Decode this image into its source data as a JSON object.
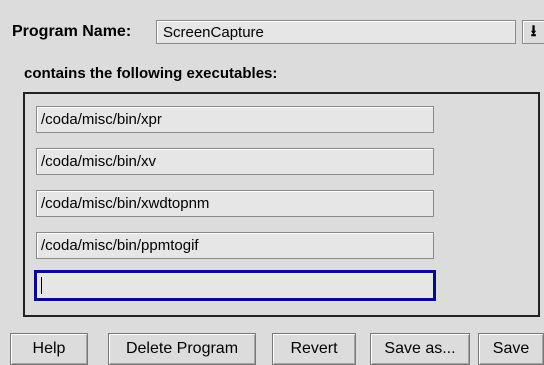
{
  "program": {
    "label": "Program Name:",
    "value": "ScreenCapture",
    "dropdown_icon": "download-arrow-icon"
  },
  "executables": {
    "heading": "contains the following executables:",
    "items": [
      "/coda/misc/bin/xpr",
      "/coda/misc/bin/xv",
      "/coda/misc/bin/xwdtopnm",
      "/coda/misc/bin/ppmtogif"
    ],
    "new_entry_value": ""
  },
  "buttons": {
    "help": "Help",
    "delete_program": "Delete Program",
    "revert": "Revert",
    "save_as": "Save as...",
    "save": "Save"
  },
  "colors": {
    "focus_border": "#0a0a8c",
    "background": "#dcdcdc"
  }
}
